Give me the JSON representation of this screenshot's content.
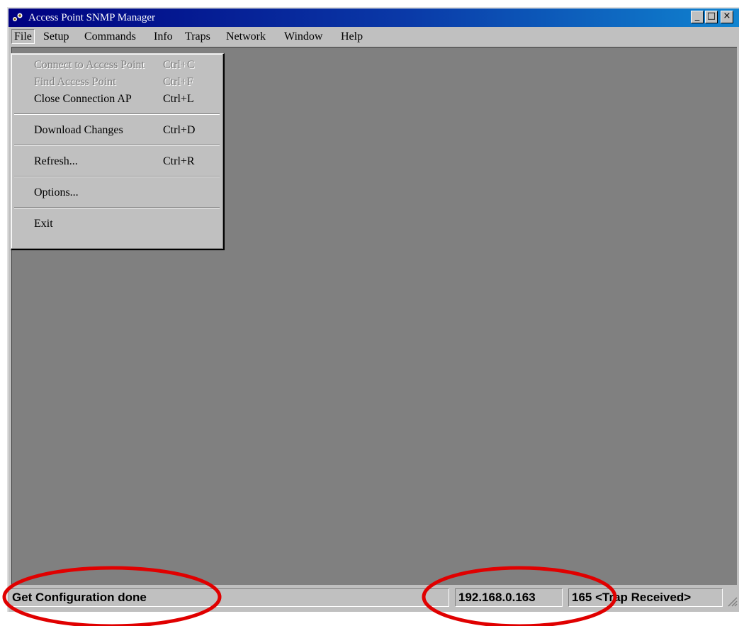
{
  "window": {
    "title": "Access Point SNMP Manager",
    "app_icon": "snmp-manager-icon",
    "buttons": {
      "minimize": "_",
      "maximize": "□",
      "close": "×"
    }
  },
  "menubar": {
    "items": [
      "File",
      "Setup",
      "Commands",
      "Info",
      "Traps",
      "Network",
      "Window",
      "Help"
    ],
    "active": "File"
  },
  "file_menu": {
    "items": [
      {
        "label": "Connect to Access Point",
        "shortcut": "Ctrl+C",
        "enabled": false
      },
      {
        "label": "Find Access Point",
        "shortcut": "Ctrl+F",
        "enabled": false
      },
      {
        "label": "Close Connection AP",
        "shortcut": "Ctrl+L",
        "enabled": true
      },
      {
        "label": "Download Changes",
        "shortcut": "Ctrl+D",
        "enabled": true
      },
      {
        "label": "Refresh...",
        "shortcut": "Ctrl+R",
        "enabled": true
      },
      {
        "label": "Options...",
        "shortcut": "",
        "enabled": true
      },
      {
        "label": "Exit",
        "shortcut": "",
        "enabled": true
      }
    ]
  },
  "statusbar": {
    "message": "Get Configuration done",
    "ip_address": "192.168.0.163",
    "trap_status": "165 <Trap Received>"
  },
  "colors": {
    "title_gradient_start": "#000080",
    "title_gradient_end": "#1084d0",
    "face": "#c0c0c0",
    "workspace": "#808080",
    "annotation": "#e00000",
    "disabled_text": "#808080"
  }
}
